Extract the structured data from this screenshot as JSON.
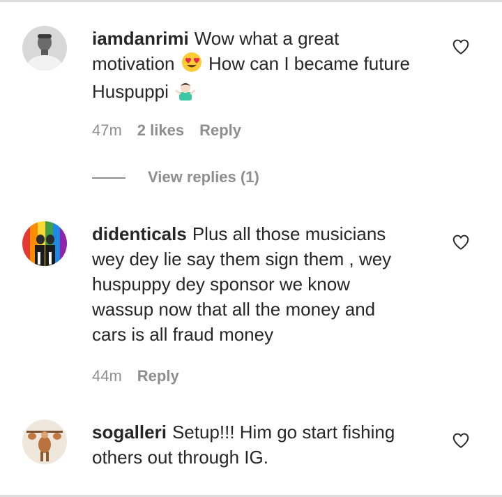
{
  "comments": [
    {
      "username": "iamdanrimi",
      "text_parts": [
        "Wow what a great motivation",
        "How can I became future Huspuppi"
      ],
      "emojis": [
        "heart-eyes-emoji",
        "shrug-emoji"
      ],
      "time": "47m",
      "likes": "2 likes",
      "reply_label": "Reply",
      "view_replies": "View replies (1)"
    },
    {
      "username": "didenticals",
      "text": "Plus all those musicians wey dey lie say them sign them , wey huspuppy dey sponsor we know wassup now that all the money and cars is all fraud money",
      "time": "44m",
      "reply_label": "Reply"
    },
    {
      "username": "sogalleri",
      "text": "Setup!!! Him go start fishing others out through IG."
    }
  ],
  "icons": {
    "like": "heart-outline-icon"
  },
  "colors": {
    "text": "#262626",
    "secondary": "#8e8e8e",
    "divider": "#dbdbdb"
  }
}
